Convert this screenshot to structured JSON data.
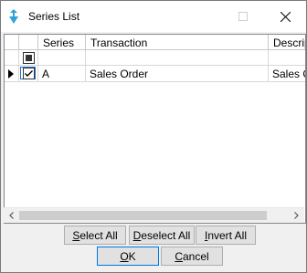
{
  "window": {
    "title": "Series List"
  },
  "grid": {
    "columns": [
      {
        "label": ""
      },
      {
        "label": "Series"
      },
      {
        "label": "Transaction"
      },
      {
        "label": "Descrip"
      }
    ],
    "rows": [
      {
        "selected": true,
        "series": "A",
        "transaction": "Sales Order",
        "description": "Sales O"
      }
    ],
    "filter_row": {
      "checkbox_state": "indeterminate"
    }
  },
  "buttons": {
    "select_all": {
      "ul": "S",
      "rest": "elect All"
    },
    "deselect_all": {
      "ul": "D",
      "rest": "eselect All"
    },
    "invert_all": {
      "ul": "I",
      "rest": "nvert All"
    },
    "ok": {
      "ul": "O",
      "rest": "K"
    },
    "cancel": {
      "ul": "C",
      "rest": "ancel"
    }
  },
  "colors": {
    "accent": "#1e70c9",
    "window_bg": "#f0f0f0"
  }
}
